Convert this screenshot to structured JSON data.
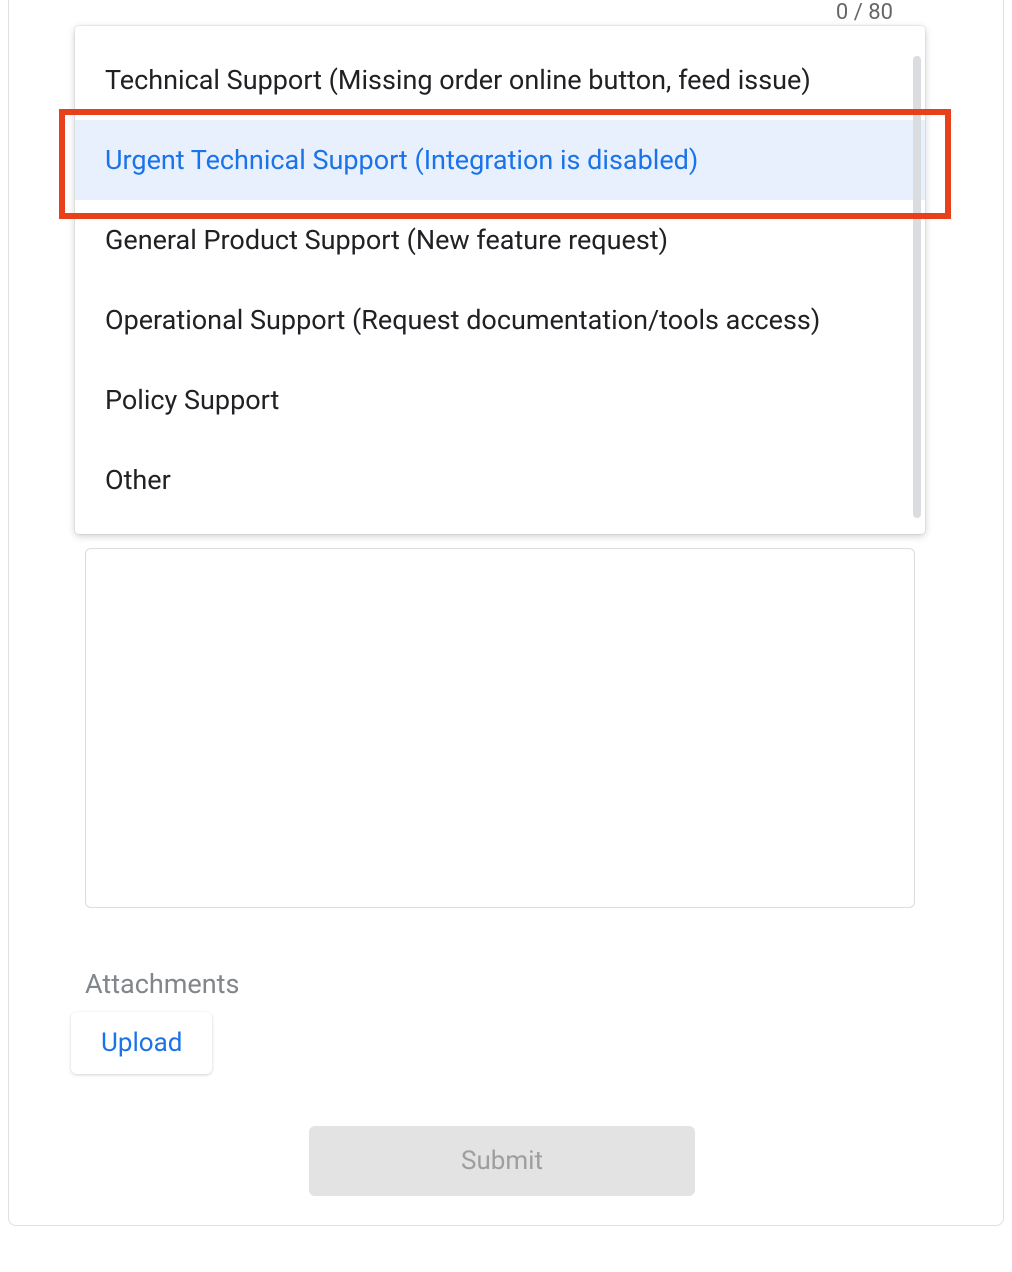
{
  "counter": "0 / 80",
  "dropdown": {
    "items": [
      {
        "label": "Technical Support (Missing order online button, feed issue)",
        "selected": false
      },
      {
        "label": "Urgent Technical Support (Integration is disabled)",
        "selected": true
      },
      {
        "label": "General Product Support (New feature request)",
        "selected": false
      },
      {
        "label": "Operational Support (Request documentation/tools access)",
        "selected": false
      },
      {
        "label": "Policy Support",
        "selected": false
      },
      {
        "label": "Other",
        "selected": false
      }
    ]
  },
  "textarea_value": "",
  "attachments_label": "Attachments",
  "upload_label": "Upload",
  "submit_label": "Submit"
}
